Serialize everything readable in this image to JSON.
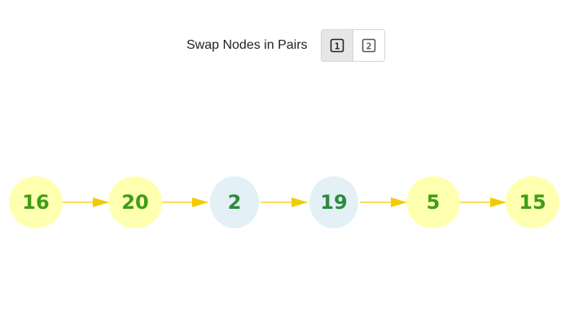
{
  "header": {
    "title": "Swap Nodes in Pairs",
    "step_buttons": [
      {
        "label": "1",
        "icon": "step-1-icon",
        "active": true
      },
      {
        "label": "2",
        "icon": "step-2-icon",
        "active": false
      }
    ]
  },
  "colors": {
    "yellow_node": "#ffffb0",
    "blue_node": "#e3f0f5",
    "label_green": "#3f9d16",
    "arrow": "#f2cc00"
  },
  "list": {
    "nodes": [
      {
        "value": "16",
        "color": "yellow"
      },
      {
        "value": "20",
        "color": "yellow"
      },
      {
        "value": "2",
        "color": "blue"
      },
      {
        "value": "19",
        "color": "blue"
      },
      {
        "value": "5",
        "color": "yellow"
      },
      {
        "value": "15",
        "color": "yellow"
      }
    ]
  }
}
